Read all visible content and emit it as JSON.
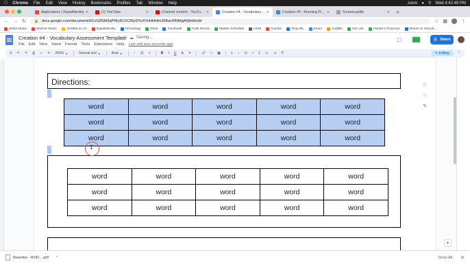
{
  "menubar": {
    "app": "Chrome",
    "items": [
      "File",
      "Edit",
      "View",
      "History",
      "Bookmarks",
      "Profiles",
      "Tab",
      "Window",
      "Help"
    ],
    "zoom_label": "zoom",
    "clock": "Wed 4:42:49 PM"
  },
  "tabs": [
    {
      "label": "Applications | RapidIdentity",
      "color": "#e8453c",
      "active": false
    },
    {
      "label": "(1) YouTube",
      "color": "#ff0000",
      "active": false
    },
    {
      "label": "Channel content - YouTube St...",
      "color": "#ff0000",
      "active": false
    },
    {
      "label": "Creation #4 - Vocabulary Asse...",
      "color": "#4285f4",
      "active": true
    },
    {
      "label": "Creation #5 - Running Plannin...",
      "color": "#4285f4",
      "active": false
    },
    {
      "label": "Screencastify",
      "color": "#9aa0a6",
      "active": false
    }
  ],
  "address": {
    "url": "docs.google.com/document/d/1oSZRAt3qPNIy9CXCiRpSYuXVnHHHimJ6BacWNMgAKjfe8/edit"
  },
  "bookmarks": [
    {
      "label": "Zelda Music",
      "color": "#e8453c"
    },
    {
      "label": "Witcher Music",
      "color": "#e8453c"
    },
    {
      "label": "Airtable 21-22",
      "color": "#fbbc04"
    },
    {
      "label": "RapidIdentity",
      "color": "#e8453c"
    },
    {
      "label": "Schoology",
      "color": "#1a73e8"
    },
    {
      "label": "Drive",
      "color": "#34a853"
    },
    {
      "label": "Facebook",
      "color": "#1877f2"
    },
    {
      "label": "AVID WAGS",
      "color": "#34a853"
    },
    {
      "label": "Master Schedule",
      "color": "#34a853"
    },
    {
      "label": "Links",
      "color": "#5f6368"
    },
    {
      "label": "Turnitin",
      "color": "#e8453c"
    },
    {
      "label": "TinyURL",
      "color": "#1a73e8"
    },
    {
      "label": "Zoom",
      "color": "#2d8cff"
    },
    {
      "label": "Audible",
      "color": "#f29a00"
    },
    {
      "label": "Our Life",
      "color": "#34a853"
    },
    {
      "label": "Hunter's Finances",
      "color": "#34a853"
    },
    {
      "label": "Return to School...",
      "color": "#1a73e8"
    }
  ],
  "docs": {
    "title": "Creation #4 - Vocabulary Assessment Template",
    "saving": "Saving...",
    "menus": [
      "File",
      "Edit",
      "View",
      "Insert",
      "Format",
      "Tools",
      "Extensions",
      "Help"
    ],
    "last_edit": "Last edit was seconds ago",
    "share_label": "Share"
  },
  "toolbar": {
    "zoom": "200%",
    "style": "Normal text",
    "font": "Arial",
    "size": "11",
    "mode": "Editing"
  },
  "document": {
    "directions": "Directions:",
    "table1": [
      [
        "word",
        "word",
        "word",
        "word",
        "word"
      ],
      [
        "word",
        "word",
        "word",
        "word",
        "word"
      ],
      [
        "word",
        "word",
        "word",
        "word",
        "word"
      ]
    ],
    "table2": [
      [
        "word",
        "word",
        "word",
        "word",
        "word"
      ],
      [
        "word",
        "word",
        "word",
        "word",
        "word"
      ],
      [
        "word",
        "word",
        "word",
        "word",
        "word"
      ]
    ]
  },
  "downloads": {
    "file": "Reardon - AVID....pdf",
    "show_all": "Show All"
  },
  "colors": {
    "selection": "#b5cef2",
    "share": "#1a73e8"
  }
}
